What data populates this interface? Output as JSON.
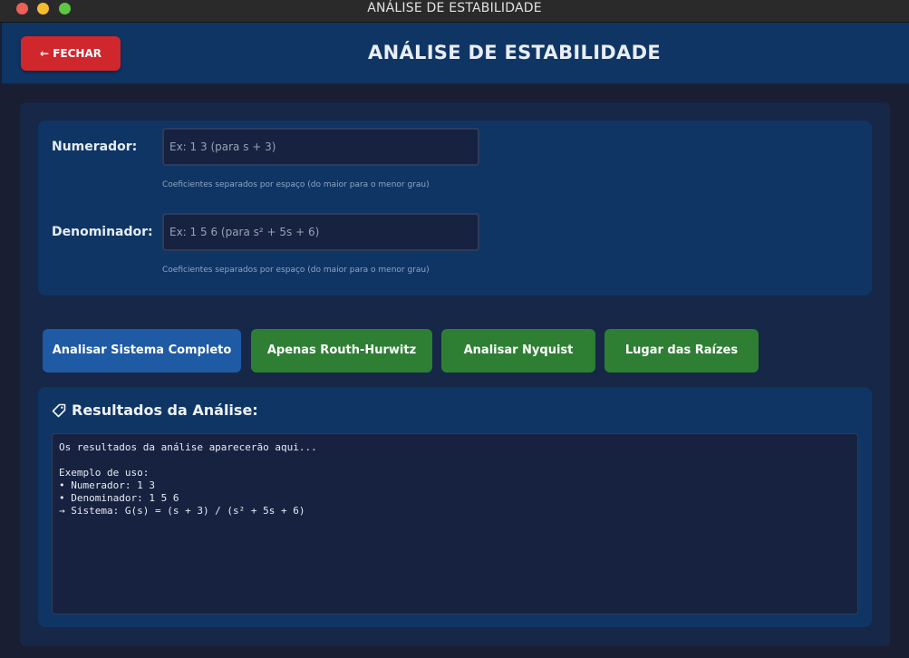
{
  "window": {
    "title": "ANÁLISE DE ESTABILIDADE"
  },
  "header": {
    "close_label": "← FECHAR",
    "title": "ANÁLISE DE ESTABILIDADE"
  },
  "form": {
    "numerator": {
      "label": "Numerador:",
      "placeholder": "Ex: 1 3 (para s + 3)",
      "value": "",
      "hint": "Coeficientes separados por espaço (do maior para o menor grau)"
    },
    "denominator": {
      "label": "Denominador:",
      "placeholder": "Ex: 1 5 6 (para s² + 5s + 6)",
      "value": "",
      "hint": "Coeficientes separados por espaço (do maior para o menor grau)"
    }
  },
  "actions": {
    "full": "Analisar Sistema Completo",
    "routh": "Apenas Routh-Hurwitz",
    "nyquist": "Analisar Nyquist",
    "root_locus": "Lugar das Raízes"
  },
  "results": {
    "title": "Resultados da Análise:",
    "text": "Os resultados da análise aparecerão aqui...\n\nExemplo de uso:\n• Numerador: 1 3\n• Denominador: 1 5 6\n→ Sistema: G(s) = (s + 3) / (s² + 5s + 6)"
  },
  "icons": {
    "close": "close-window-icon",
    "minimize": "minimize-window-icon",
    "zoom": "zoom-window-icon",
    "results": "tag-icon"
  },
  "colors": {
    "header_bg": "#0f3565",
    "close_button": "#d0272d",
    "primary_button": "#1f5aa5",
    "secondary_button": "#2e7f34",
    "input_bg": "#172240"
  }
}
